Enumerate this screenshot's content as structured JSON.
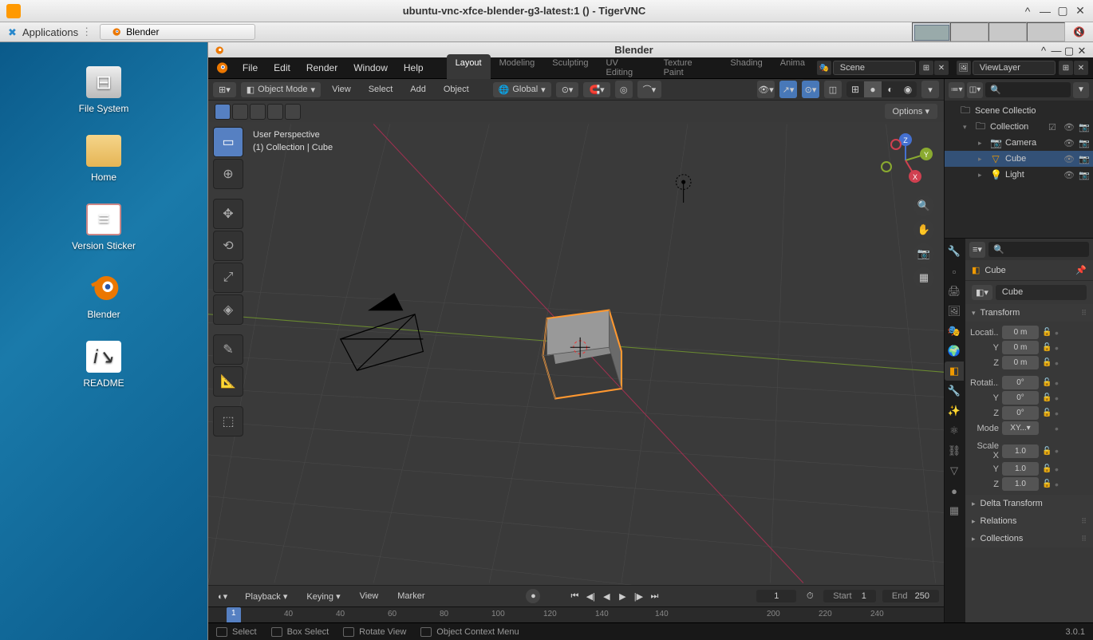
{
  "vnc": {
    "title": "ubuntu-vnc-xfce-blender-g3-latest:1 () - TigerVNC"
  },
  "xfce": {
    "apps_label": "Applications",
    "task_label": "Blender",
    "desktop_icons": [
      {
        "label": "File System",
        "type": "drive"
      },
      {
        "label": "Home",
        "type": "folder"
      },
      {
        "label": "Version Sticker",
        "type": "doc"
      },
      {
        "label": "Blender",
        "type": "blender"
      },
      {
        "label": "README",
        "type": "txt"
      }
    ]
  },
  "blender": {
    "title": "Blender",
    "menus": [
      "File",
      "Edit",
      "Render",
      "Window",
      "Help"
    ],
    "workspace_tabs": [
      "Layout",
      "Modeling",
      "Sculpting",
      "UV Editing",
      "Texture Paint",
      "Shading",
      "Anima"
    ],
    "active_tab": "Layout",
    "scene_name": "Scene",
    "viewlayer_name": "ViewLayer",
    "viewport": {
      "mode": "Object Mode",
      "view_menu": "View",
      "select_menu": "Select",
      "add_menu": "Add",
      "object_menu": "Object",
      "orientation": "Global",
      "info_line1": "User Perspective",
      "info_line2": "(1) Collection | Cube",
      "options_btn": "Options"
    },
    "timeline": {
      "playback": "Playback",
      "keying": "Keying",
      "view": "View",
      "marker": "Marker",
      "current_frame": "1",
      "start_label": "Start",
      "start": "1",
      "end_label": "End",
      "end": "250",
      "ruler_ticks": [
        "1",
        "40",
        "60",
        "80",
        "100",
        "120",
        "140"
      ]
    },
    "status": {
      "select": "Select",
      "box_select": "Box Select",
      "rotate_view": "Rotate View",
      "context_menu": "Object Context Menu",
      "version": "3.0.1"
    },
    "outliner": {
      "search_placeholder": "",
      "items": [
        {
          "label": "Scene Collectio",
          "icon": "scene",
          "depth": 0,
          "selected": false,
          "chev": ""
        },
        {
          "label": "Collection",
          "icon": "collection",
          "depth": 1,
          "selected": false,
          "chev": "▾",
          "checked": true
        },
        {
          "label": "Camera",
          "icon": "camera",
          "depth": 2,
          "selected": false,
          "chev": "▸"
        },
        {
          "label": "Cube",
          "icon": "mesh",
          "depth": 2,
          "selected": true,
          "chev": "▸"
        },
        {
          "label": "Light",
          "icon": "light",
          "depth": 2,
          "selected": false,
          "chev": "▸"
        }
      ]
    },
    "properties": {
      "object_name": "Cube",
      "name_field": "Cube",
      "panels": {
        "transform": {
          "title": "Transform",
          "location_label": "Locati...",
          "rotation_label": "Rotati...",
          "scale_label": "Scale X",
          "mode_label": "Mode",
          "loc": {
            "x": "0 m",
            "y": "0 m",
            "z": "0 m"
          },
          "rot": {
            "x": "0°",
            "y": "0°",
            "z": "0°",
            "mode": "XY..."
          },
          "scale": {
            "x": "1.0",
            "y": "1.0",
            "z": "1.0"
          }
        },
        "delta": "Delta Transform",
        "relations": "Relations",
        "collections": "Collections"
      }
    }
  }
}
